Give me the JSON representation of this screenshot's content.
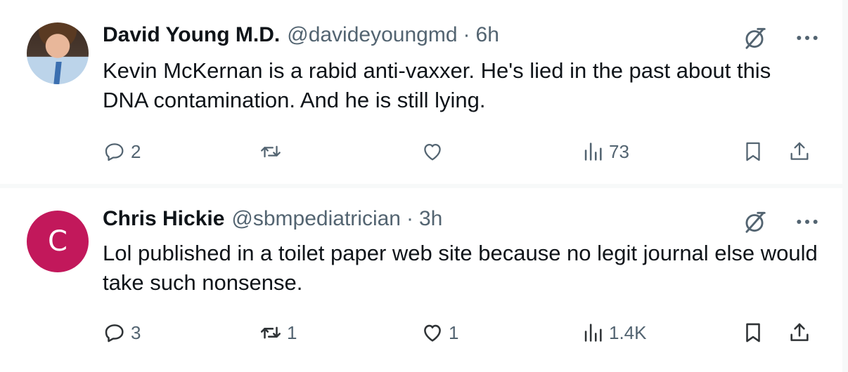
{
  "tweets": [
    {
      "author_name": "David Young M.D.",
      "handle": "@davideyoungmd",
      "separator": "·",
      "time": "6h",
      "text": "Kevin McKernan is a rabid anti-vaxxer.  He's lied in the past about this DNA contamination.  And he is still lying.",
      "avatar": "photo",
      "replies": "2",
      "retweets": "",
      "likes": "",
      "views": "73"
    },
    {
      "author_name": "Chris Hickie",
      "handle": "@sbmpediatrician",
      "separator": "·",
      "time": "3h",
      "text": "Lol published in a toilet paper web site because no legit journal else would take such nonsense.",
      "avatar_letter": "C",
      "avatar_color": "#c2185b",
      "replies": "3",
      "retweets": "1",
      "likes": "1",
      "views": "1.4K"
    }
  ],
  "colors": {
    "secondary_text": "#536471",
    "primary_text": "#0f1419",
    "background": "#ffffff",
    "divider": "#f7f9f9"
  },
  "icons": [
    "grok-icon",
    "more-icon",
    "reply-icon",
    "retweet-icon",
    "like-icon",
    "views-icon",
    "bookmark-icon",
    "share-icon"
  ]
}
